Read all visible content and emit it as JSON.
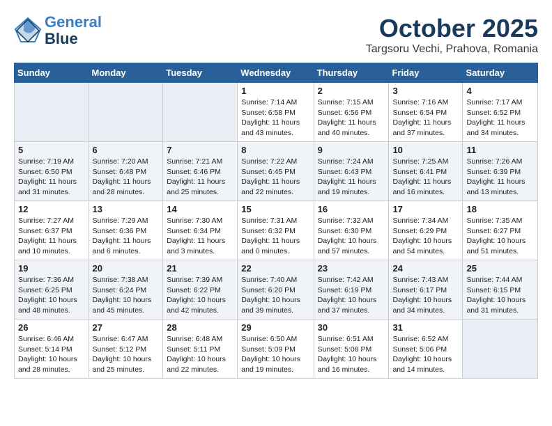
{
  "header": {
    "logo_line1": "General",
    "logo_line2": "Blue",
    "month": "October 2025",
    "location": "Targsoru Vechi, Prahova, Romania"
  },
  "weekdays": [
    "Sunday",
    "Monday",
    "Tuesday",
    "Wednesday",
    "Thursday",
    "Friday",
    "Saturday"
  ],
  "weeks": [
    [
      {
        "day": "",
        "content": ""
      },
      {
        "day": "",
        "content": ""
      },
      {
        "day": "",
        "content": ""
      },
      {
        "day": "1",
        "content": "Sunrise: 7:14 AM\nSunset: 6:58 PM\nDaylight: 11 hours and 43 minutes."
      },
      {
        "day": "2",
        "content": "Sunrise: 7:15 AM\nSunset: 6:56 PM\nDaylight: 11 hours and 40 minutes."
      },
      {
        "day": "3",
        "content": "Sunrise: 7:16 AM\nSunset: 6:54 PM\nDaylight: 11 hours and 37 minutes."
      },
      {
        "day": "4",
        "content": "Sunrise: 7:17 AM\nSunset: 6:52 PM\nDaylight: 11 hours and 34 minutes."
      }
    ],
    [
      {
        "day": "5",
        "content": "Sunrise: 7:19 AM\nSunset: 6:50 PM\nDaylight: 11 hours and 31 minutes."
      },
      {
        "day": "6",
        "content": "Sunrise: 7:20 AM\nSunset: 6:48 PM\nDaylight: 11 hours and 28 minutes."
      },
      {
        "day": "7",
        "content": "Sunrise: 7:21 AM\nSunset: 6:46 PM\nDaylight: 11 hours and 25 minutes."
      },
      {
        "day": "8",
        "content": "Sunrise: 7:22 AM\nSunset: 6:45 PM\nDaylight: 11 hours and 22 minutes."
      },
      {
        "day": "9",
        "content": "Sunrise: 7:24 AM\nSunset: 6:43 PM\nDaylight: 11 hours and 19 minutes."
      },
      {
        "day": "10",
        "content": "Sunrise: 7:25 AM\nSunset: 6:41 PM\nDaylight: 11 hours and 16 minutes."
      },
      {
        "day": "11",
        "content": "Sunrise: 7:26 AM\nSunset: 6:39 PM\nDaylight: 11 hours and 13 minutes."
      }
    ],
    [
      {
        "day": "12",
        "content": "Sunrise: 7:27 AM\nSunset: 6:37 PM\nDaylight: 11 hours and 10 minutes."
      },
      {
        "day": "13",
        "content": "Sunrise: 7:29 AM\nSunset: 6:36 PM\nDaylight: 11 hours and 6 minutes."
      },
      {
        "day": "14",
        "content": "Sunrise: 7:30 AM\nSunset: 6:34 PM\nDaylight: 11 hours and 3 minutes."
      },
      {
        "day": "15",
        "content": "Sunrise: 7:31 AM\nSunset: 6:32 PM\nDaylight: 11 hours and 0 minutes."
      },
      {
        "day": "16",
        "content": "Sunrise: 7:32 AM\nSunset: 6:30 PM\nDaylight: 10 hours and 57 minutes."
      },
      {
        "day": "17",
        "content": "Sunrise: 7:34 AM\nSunset: 6:29 PM\nDaylight: 10 hours and 54 minutes."
      },
      {
        "day": "18",
        "content": "Sunrise: 7:35 AM\nSunset: 6:27 PM\nDaylight: 10 hours and 51 minutes."
      }
    ],
    [
      {
        "day": "19",
        "content": "Sunrise: 7:36 AM\nSunset: 6:25 PM\nDaylight: 10 hours and 48 minutes."
      },
      {
        "day": "20",
        "content": "Sunrise: 7:38 AM\nSunset: 6:24 PM\nDaylight: 10 hours and 45 minutes."
      },
      {
        "day": "21",
        "content": "Sunrise: 7:39 AM\nSunset: 6:22 PM\nDaylight: 10 hours and 42 minutes."
      },
      {
        "day": "22",
        "content": "Sunrise: 7:40 AM\nSunset: 6:20 PM\nDaylight: 10 hours and 39 minutes."
      },
      {
        "day": "23",
        "content": "Sunrise: 7:42 AM\nSunset: 6:19 PM\nDaylight: 10 hours and 37 minutes."
      },
      {
        "day": "24",
        "content": "Sunrise: 7:43 AM\nSunset: 6:17 PM\nDaylight: 10 hours and 34 minutes."
      },
      {
        "day": "25",
        "content": "Sunrise: 7:44 AM\nSunset: 6:15 PM\nDaylight: 10 hours and 31 minutes."
      }
    ],
    [
      {
        "day": "26",
        "content": "Sunrise: 6:46 AM\nSunset: 5:14 PM\nDaylight: 10 hours and 28 minutes."
      },
      {
        "day": "27",
        "content": "Sunrise: 6:47 AM\nSunset: 5:12 PM\nDaylight: 10 hours and 25 minutes."
      },
      {
        "day": "28",
        "content": "Sunrise: 6:48 AM\nSunset: 5:11 PM\nDaylight: 10 hours and 22 minutes."
      },
      {
        "day": "29",
        "content": "Sunrise: 6:50 AM\nSunset: 5:09 PM\nDaylight: 10 hours and 19 minutes."
      },
      {
        "day": "30",
        "content": "Sunrise: 6:51 AM\nSunset: 5:08 PM\nDaylight: 10 hours and 16 minutes."
      },
      {
        "day": "31",
        "content": "Sunrise: 6:52 AM\nSunset: 5:06 PM\nDaylight: 10 hours and 14 minutes."
      },
      {
        "day": "",
        "content": ""
      }
    ]
  ]
}
